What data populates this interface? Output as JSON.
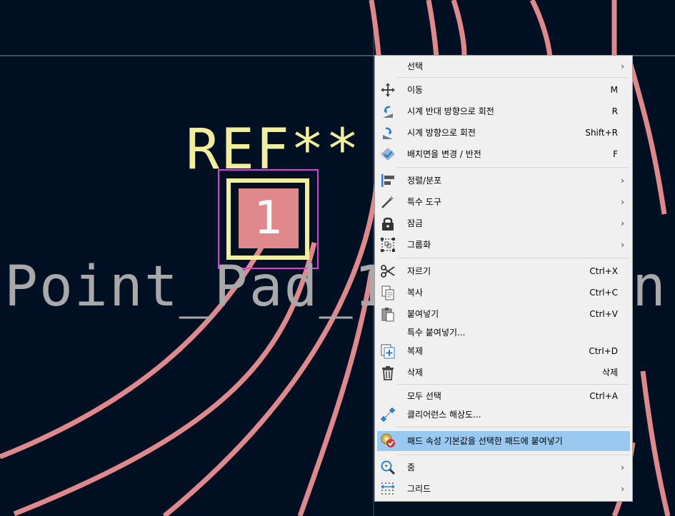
{
  "editor": {
    "ref_text": "REF**",
    "value_text": "Point_Pad_1.",
    "value_text_tail": "n",
    "pad_number": "1",
    "colors": {
      "background": "#001023",
      "track": "#e0888c",
      "ref": "#f2ee9a",
      "selection": "#e838e0",
      "value": "#a9a9a9"
    }
  },
  "menu": {
    "items": [
      {
        "label": "선택",
        "shortcut": "",
        "submenu": true,
        "icon": ""
      },
      {
        "label": "이동",
        "shortcut": "M",
        "submenu": false,
        "icon": "move-icon"
      },
      {
        "label": "시계 반대 방향으로 회전",
        "shortcut": "R",
        "submenu": false,
        "icon": "rotate-ccw-icon"
      },
      {
        "label": "시계 방향으로 회전",
        "shortcut": "Shift+R",
        "submenu": false,
        "icon": "rotate-cw-icon"
      },
      {
        "label": "배치면을 변경 / 반전",
        "shortcut": "F",
        "submenu": false,
        "icon": "flip-icon"
      },
      {
        "label": "정렬/분포",
        "shortcut": "",
        "submenu": true,
        "icon": "align-icon"
      },
      {
        "label": "특수 도구",
        "shortcut": "",
        "submenu": true,
        "icon": "magic-wand-icon"
      },
      {
        "label": "잠금",
        "shortcut": "",
        "submenu": true,
        "icon": "lock-icon"
      },
      {
        "label": "그룹화",
        "shortcut": "",
        "submenu": true,
        "icon": "group-icon"
      },
      {
        "label": "자르기",
        "shortcut": "Ctrl+X",
        "submenu": false,
        "icon": "scissors-icon"
      },
      {
        "label": "복사",
        "shortcut": "Ctrl+C",
        "submenu": false,
        "icon": "copy-icon"
      },
      {
        "label": "붙여넣기",
        "shortcut": "Ctrl+V",
        "submenu": false,
        "icon": "paste-icon"
      },
      {
        "label": "특수 붙여넣기...",
        "shortcut": "",
        "submenu": false,
        "icon": ""
      },
      {
        "label": "복제",
        "shortcut": "Ctrl+D",
        "submenu": false,
        "icon": "duplicate-icon"
      },
      {
        "label": "삭제",
        "shortcut": "삭제",
        "submenu": false,
        "icon": "trash-icon"
      },
      {
        "label": "모두 선택",
        "shortcut": "Ctrl+A",
        "submenu": false,
        "icon": ""
      },
      {
        "label": "클리어런스 해상도...",
        "shortcut": "",
        "submenu": false,
        "icon": "clearance-icon"
      },
      {
        "label": "패드 속성 기본값을 선택한 패드에 붙여넣기",
        "shortcut": "",
        "submenu": false,
        "icon": "pad-paste-icon",
        "highlighted": true
      },
      {
        "label": "줌",
        "shortcut": "",
        "submenu": true,
        "icon": "zoom-icon"
      },
      {
        "label": "그리드",
        "shortcut": "",
        "submenu": true,
        "icon": "grid-icon"
      }
    ]
  }
}
